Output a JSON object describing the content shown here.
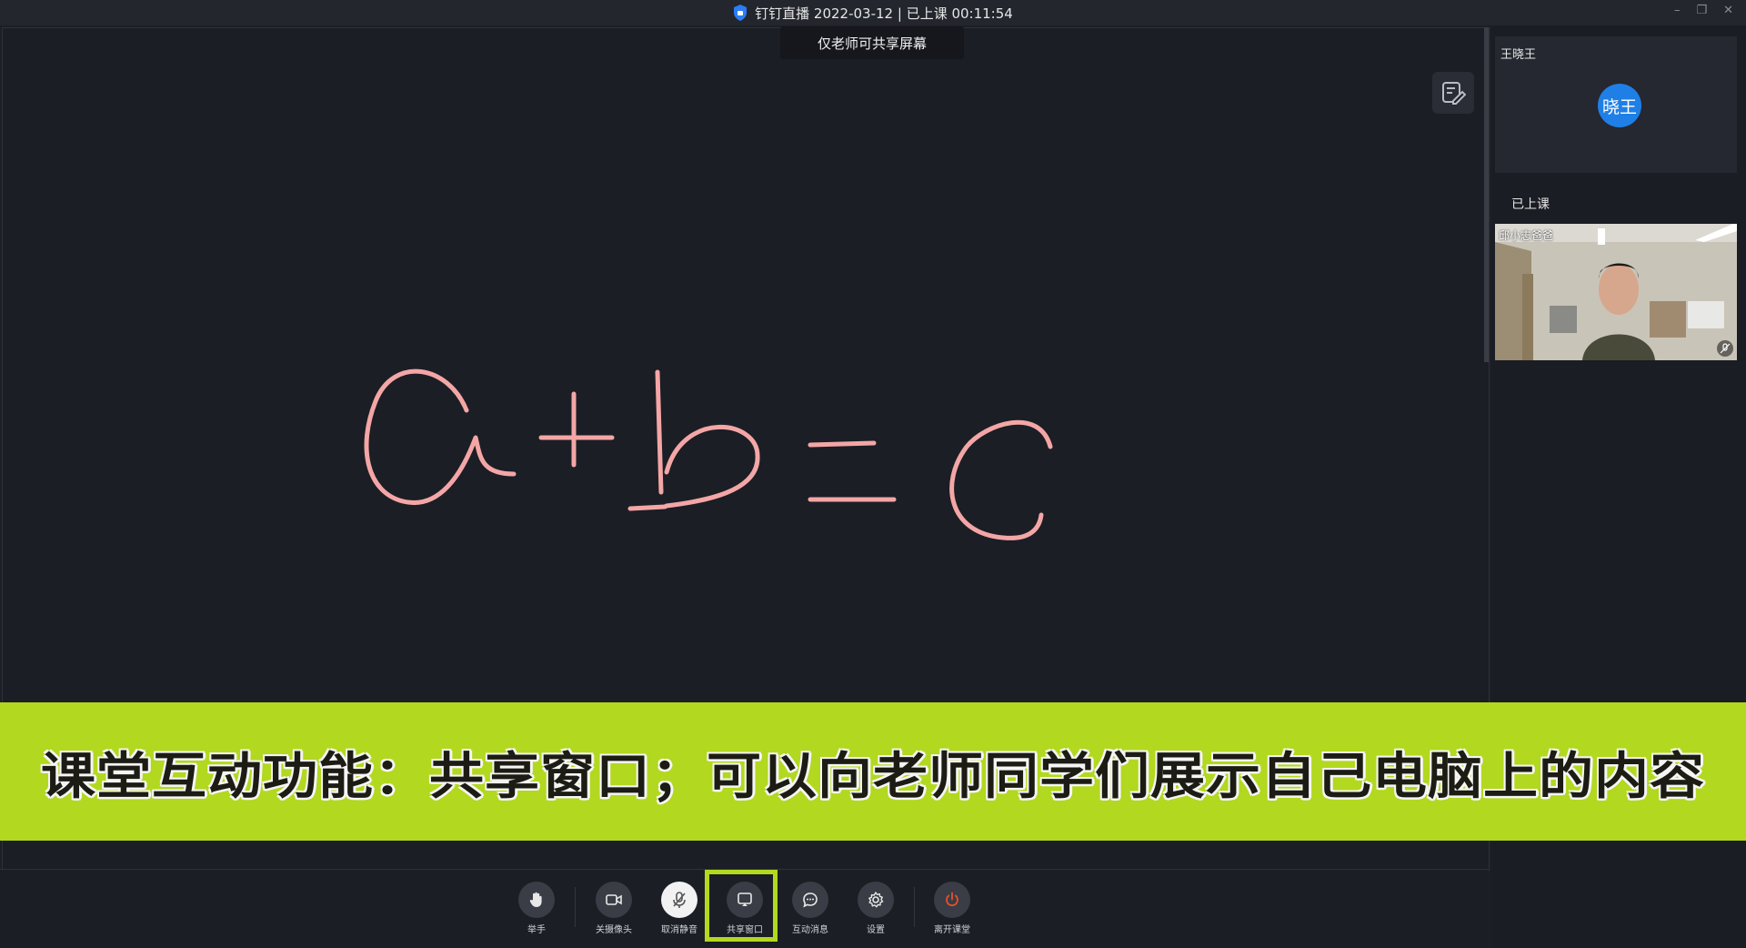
{
  "window": {
    "title": "钉钉直播 2022-03-12 | 已上课 00:11:54",
    "controls": [
      "–",
      "❐",
      "✕"
    ]
  },
  "tooltip": {
    "text": "仅老师可共享屏幕"
  },
  "stage": {
    "whiteboard_content": "a + b = c",
    "ink_color": "#f4a6a6",
    "edit_icon": "annotate-icon"
  },
  "sidebar": {
    "host": {
      "name": "王晓王",
      "avatar_text": "晓王",
      "avatar_color": "#1f7fe6"
    },
    "section_label": "已上课",
    "video": {
      "name": "邱小志爸爸"
    }
  },
  "caption": {
    "text": "课堂互动功能：共享窗口；可以向老师同学们展示自己电脑上的内容",
    "background": "#b2d81f"
  },
  "toolbar": {
    "buttons": [
      {
        "label": "举手",
        "icon": "hand-icon"
      },
      {
        "label": "关摄像头",
        "icon": "camera-icon"
      },
      {
        "label": "取消静音",
        "icon": "mic-off-icon"
      },
      {
        "label": "共享窗口",
        "icon": "share-screen-icon"
      },
      {
        "label": "互动消息",
        "icon": "chat-icon"
      },
      {
        "label": "设置",
        "icon": "gear-icon"
      },
      {
        "label": "离开课堂",
        "icon": "power-icon"
      }
    ],
    "highlighted": "共享窗口",
    "leave_color": "#e8502a"
  }
}
